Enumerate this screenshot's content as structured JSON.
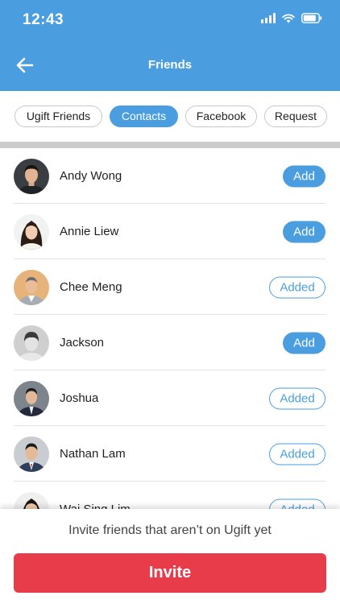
{
  "status_bar": {
    "time": "12:43"
  },
  "nav": {
    "title": "Friends",
    "back_icon": "arrow-left-icon"
  },
  "tabs": [
    {
      "label": "Ugift Friends",
      "active": false
    },
    {
      "label": "Contacts",
      "active": true
    },
    {
      "label": "Facebook",
      "active": false
    },
    {
      "label": "Request",
      "active": false
    }
  ],
  "contacts": [
    {
      "name": "Andy Wong",
      "action": "Add"
    },
    {
      "name": "Annie Liew",
      "action": "Add"
    },
    {
      "name": "Chee Meng",
      "action": "Added"
    },
    {
      "name": "Jackson",
      "action": "Add"
    },
    {
      "name": "Joshua",
      "action": "Added"
    },
    {
      "name": "Nathan Lam",
      "action": "Added"
    },
    {
      "name": "Wai Sing Lim",
      "action": "Added"
    }
  ],
  "footer": {
    "invite_text": "Invite friends that aren’t on Ugift yet",
    "invite_button": "Invite"
  },
  "colors": {
    "primary": "#4a9ee0",
    "invite": "#e93c4a"
  }
}
